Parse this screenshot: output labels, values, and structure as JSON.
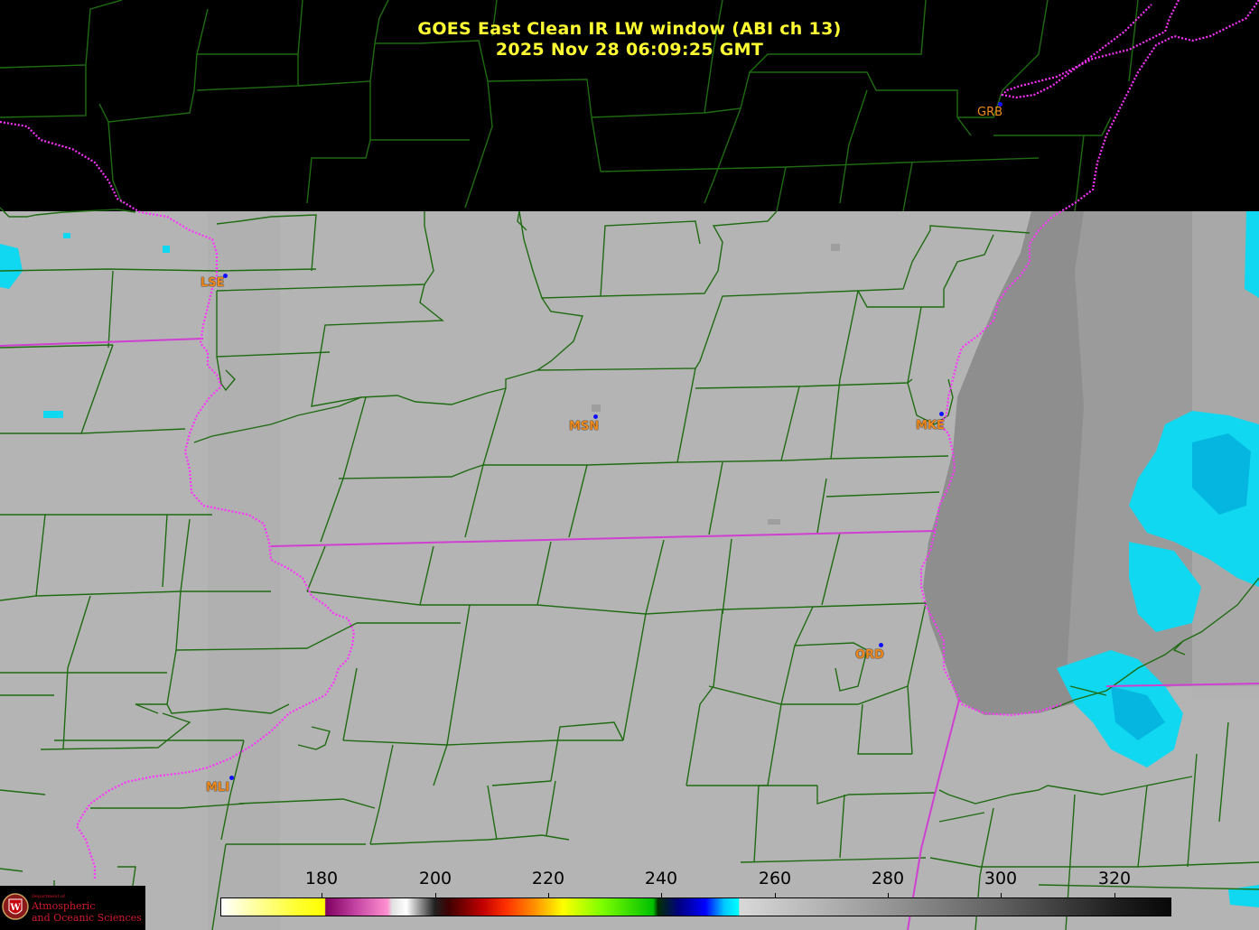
{
  "title": {
    "line1": "GOES East Clean IR LW window (ABI ch 13)",
    "line2": "2025 Nov 28  06:09:25 GMT"
  },
  "stations": [
    {
      "id": "GRB",
      "label": "GRB"
    },
    {
      "id": "LSE",
      "label": "LSE"
    },
    {
      "id": "MSN",
      "label": "MSN"
    },
    {
      "id": "MKE",
      "label": "MKE"
    },
    {
      "id": "ORD",
      "label": "ORD"
    },
    {
      "id": "MLI",
      "label": "MLI"
    }
  ],
  "colorbar": {
    "ticks": [
      "180",
      "200",
      "220",
      "240",
      "260",
      "280",
      "300",
      "320"
    ],
    "colors": {
      "cold_bright": "#ffff00",
      "magenta": "#c040a0",
      "red": "#c00000",
      "green": "#00c000",
      "cyan": "#00ffff",
      "warm_gray": "#a0a0a0"
    }
  },
  "map_colors": {
    "background_no_data": "#000000",
    "cloud_free": "#b4b4b4",
    "lake_michigan": "#888888",
    "cold_cloud": "#00d8ff",
    "county_lines": "#1f6b12",
    "state_lines": "#d040d0",
    "river_lines": "#ff33ff"
  },
  "logo": {
    "department": "Department of",
    "line1": "Atmospheric",
    "line2": "and Oceanic Sciences"
  }
}
